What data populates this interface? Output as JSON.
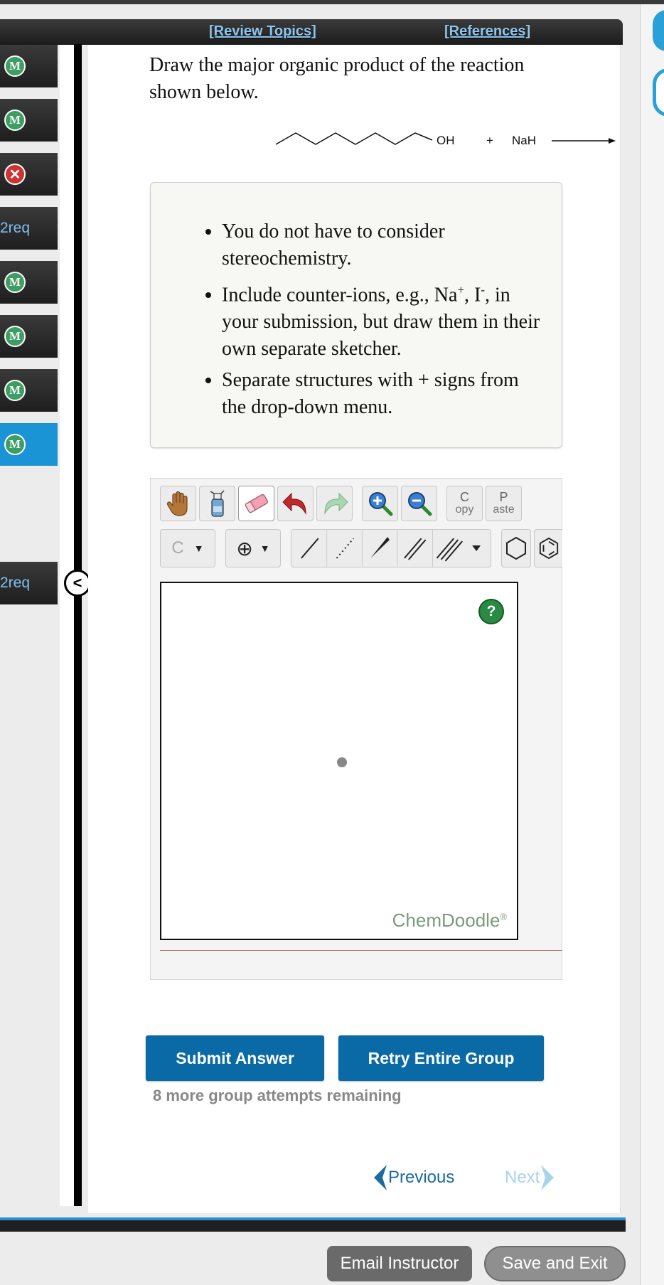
{
  "header": {
    "review_topics": "[Review Topics]",
    "references": "[References]"
  },
  "sidebar": {
    "items": [
      {
        "type": "m",
        "label": "M"
      },
      {
        "type": "m",
        "label": "M"
      },
      {
        "type": "x",
        "label": "✕"
      },
      {
        "type": "req",
        "label": "2req"
      },
      {
        "type": "m",
        "label": "M"
      },
      {
        "type": "m",
        "label": "M"
      },
      {
        "type": "m",
        "label": "M"
      },
      {
        "type": "m",
        "label": "M"
      },
      {
        "type": "req",
        "label": "2req"
      }
    ],
    "collapse_label": "<"
  },
  "question": {
    "text": "Draw the major organic product of the reaction shown below.",
    "oh_label": "OH",
    "plus": "+",
    "reagent": "NaH"
  },
  "instructions": {
    "item1": "You do not have to consider stereochemistry.",
    "item2_a": "Include counter-ions, e.g., Na",
    "item2_sup1": "+",
    "item2_b": ", I",
    "item2_sup2": "-",
    "item2_c": ", in your submission, but draw them in their own separate sketcher.",
    "item3": "Separate structures with + signs from the drop-down menu."
  },
  "sketcher": {
    "copy_top": "C",
    "copy_bottom": "opy",
    "paste_top": "P",
    "paste_bottom": "aste",
    "atom_label": "C",
    "help_label": "?",
    "brand": "ChemDoodle",
    "brand_mark": "®"
  },
  "actions": {
    "submit": "Submit Answer",
    "retry": "Retry Entire Group",
    "attempts": "8 more group attempts remaining",
    "previous": "Previous",
    "next": "Next"
  },
  "footer": {
    "email": "Email Instructor",
    "save": "Save and Exit"
  },
  "colors": {
    "accent": "#0a6aa6",
    "mastered": "#3d9d62",
    "error": "#cc3333",
    "active": "#1b94d6"
  }
}
